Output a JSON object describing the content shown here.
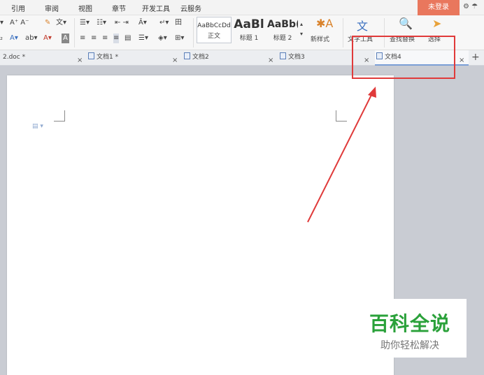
{
  "menubar": {
    "items": [
      "引用",
      "审阅",
      "视图",
      "章节",
      "开发工具",
      "云服务"
    ],
    "login": "未登录"
  },
  "ribbon": {
    "styles": [
      {
        "sample": "AaBbCcDd",
        "name": "正文"
      },
      {
        "sample": "AaBl",
        "name": "标题 1"
      },
      {
        "sample": "AaBb(",
        "name": "标题 2"
      }
    ],
    "new_style": "新样式",
    "text_tools": "文字工具",
    "find_replace": "查找替换",
    "select": "选择"
  },
  "tabs": [
    {
      "label": "2.doc *"
    },
    {
      "label": "文档1 *"
    },
    {
      "label": "文档2"
    },
    {
      "label": "文档3"
    },
    {
      "label": "文档4"
    }
  ],
  "watermark": {
    "title": "百科全说",
    "subtitle": "助你轻松解决"
  },
  "colors": {
    "accent": "#e9775d",
    "annotation": "#e03a3a",
    "watermark_green": "#2aa13a"
  }
}
